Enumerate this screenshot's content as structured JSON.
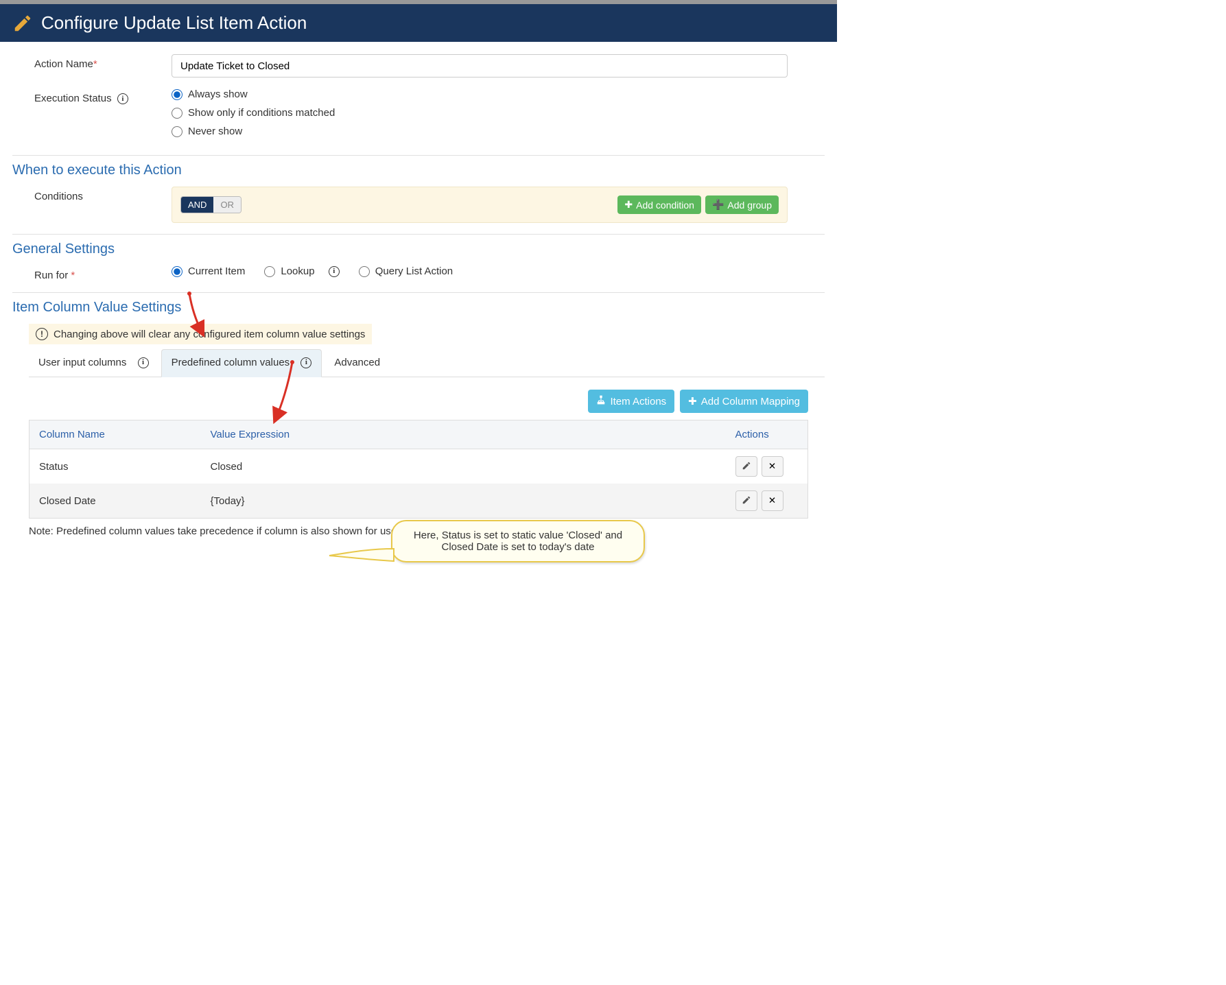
{
  "header": {
    "title": "Configure Update List Item Action"
  },
  "form": {
    "action_name_label": "Action Name",
    "action_name_value": "Update Ticket to Closed",
    "execution_status_label": "Execution Status",
    "execution_options": {
      "always": "Always show",
      "conditions": "Show only if conditions matched",
      "never": "Never show"
    }
  },
  "sections": {
    "when": "When to execute this Action",
    "general": "General Settings",
    "item_col": "Item Column Value Settings"
  },
  "conditions": {
    "label": "Conditions",
    "and": "AND",
    "or": "OR",
    "add_condition": "Add condition",
    "add_group": "Add group"
  },
  "runfor": {
    "label": "Run for",
    "current": "Current Item",
    "lookup": "Lookup",
    "query": "Query List Action"
  },
  "warning": "Changing above will clear any configured item column value settings",
  "tabs": {
    "user_input": "User input columns",
    "predefined": "Predefined column values",
    "advanced": "Advanced"
  },
  "tab_buttons": {
    "item_actions": "Item Actions",
    "add_mapping": "Add Column Mapping"
  },
  "table": {
    "headers": {
      "col": "Column Name",
      "val": "Value Expression",
      "act": "Actions"
    },
    "rows": [
      {
        "col": "Status",
        "val": "Closed"
      },
      {
        "col": "Closed Date",
        "val": "{Today}"
      }
    ]
  },
  "note": "Note: Predefined column values take precedence if column is also shown for user input",
  "callout": "Here, Status is set to static value 'Closed' and Closed Date is set to today's date"
}
